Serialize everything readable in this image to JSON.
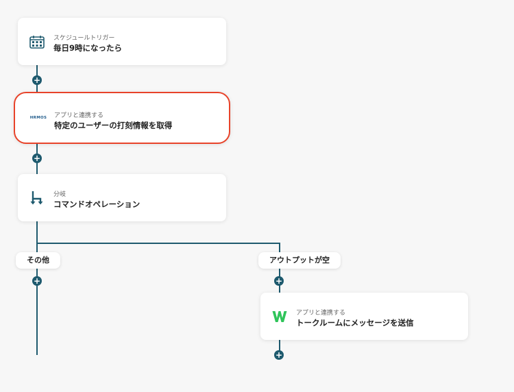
{
  "steps": [
    {
      "subtitle": "スケジュールトリガー",
      "title": "毎日9時になったら",
      "icon": "calendar-icon"
    },
    {
      "subtitle": "アプリと連携する",
      "title": "特定のユーザーの打刻情報を取得",
      "icon": "hrmos-logo-icon",
      "logo_text": "HRMOS"
    },
    {
      "subtitle": "分岐",
      "title": "コマンドオペレーション",
      "icon": "branch-icon"
    },
    {
      "subtitle": "アプリと連携する",
      "title": "トークルームにメッセージを送信",
      "icon": "works-logo-icon"
    }
  ],
  "branches": [
    {
      "label": "その他"
    },
    {
      "label": "アウトプットが空"
    }
  ],
  "add_button_label": "+",
  "colors": {
    "connector": "#1e5a6e",
    "selected_border": "#e8432a",
    "works_green": "#2fc45a"
  }
}
